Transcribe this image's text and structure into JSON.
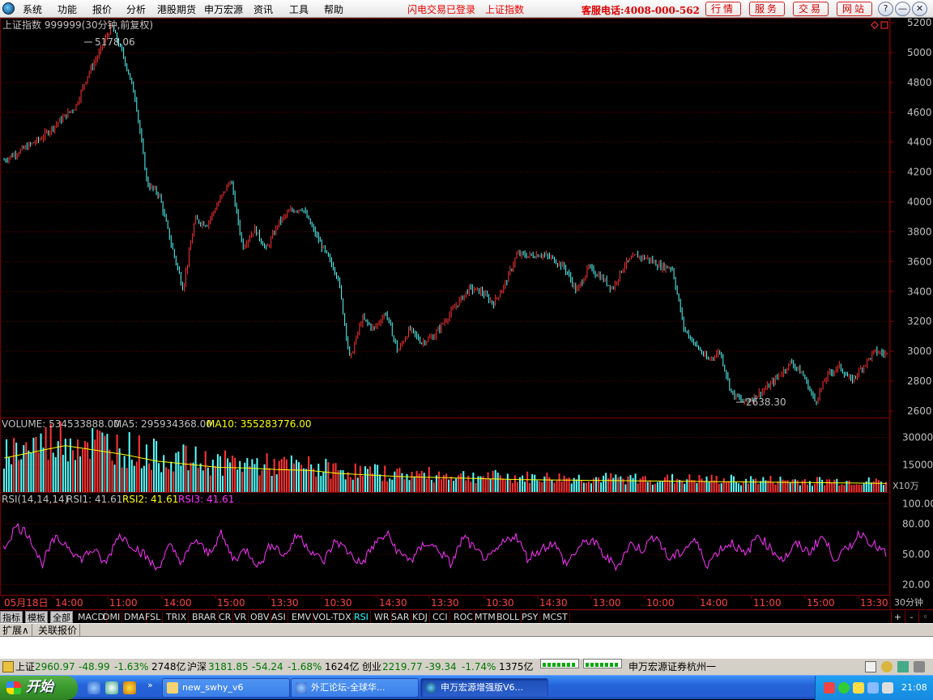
{
  "menu": {
    "items": [
      "系统",
      "功能",
      "报价",
      "分析",
      "港股期货",
      "申万宏源",
      "资讯",
      "工具",
      "帮助"
    ],
    "status_left": "闪电交易已登录",
    "status_right": "上证指数",
    "hotline": "客服电话:4008-000-562",
    "buttons": [
      "行情",
      "服务",
      "交易",
      "网站"
    ]
  },
  "window_controls": [
    "?",
    "—",
    "❐",
    "✕"
  ],
  "main_panel": {
    "title": "上证指数 999999(30分钟,前复权)",
    "high_label": "5178.06",
    "low_label": "2638.30",
    "y_ticks": [
      "5200",
      "5000",
      "4800",
      "4600",
      "4400",
      "4200",
      "4000",
      "3800",
      "3600",
      "3400",
      "3200",
      "3000",
      "2800",
      "2600"
    ]
  },
  "volume_panel": {
    "label": "VOLUME: 534533888.00",
    "ma5": "MA5: 295934368.00",
    "ma10": "MA10: 355283776.00",
    "y_ticks": [
      "30000",
      "15000"
    ],
    "unit": "X10万"
  },
  "rsi_panel": {
    "label": "RSI(14,14,14)",
    "rsi1": "RSI1: 41.61",
    "rsi2": "RSI2: 41.61",
    "rsi3": "RSI3: 41.61",
    "y_ticks": [
      "100.00",
      "80.00",
      "50.00",
      "20.00"
    ]
  },
  "x_axis": {
    "labels": [
      "05月18日",
      "14:00",
      "11:00",
      "14:00",
      "15:00",
      "13:30",
      "10:30",
      "14:30",
      "13:30",
      "10:30",
      "14:30",
      "13:00",
      "10:00",
      "14:00",
      "11:00",
      "15:00",
      "13:30",
      "10:30"
    ],
    "period": "30分钟"
  },
  "chart_data": [
    {
      "type": "candlestick",
      "title": "上证指数 999999(30分钟,前复权)",
      "y_range": [
        2600,
        5200
      ],
      "close_path": [
        [
          0,
          4280
        ],
        [
          3,
          4420
        ],
        [
          6,
          4640
        ],
        [
          7,
          4850
        ],
        [
          8,
          5000
        ],
        [
          9,
          5178.06
        ],
        [
          10,
          4980
        ],
        [
          11,
          4700
        ],
        [
          12,
          4120
        ],
        [
          13,
          4050
        ],
        [
          14,
          3720
        ],
        [
          15,
          3420
        ],
        [
          16,
          3880
        ],
        [
          17,
          3850
        ],
        [
          18,
          4000
        ],
        [
          19,
          4150
        ],
        [
          20,
          3700
        ],
        [
          21,
          3820
        ],
        [
          22,
          3680
        ],
        [
          23,
          3860
        ],
        [
          24,
          3940
        ],
        [
          25,
          3960
        ],
        [
          26,
          3800
        ],
        [
          27,
          3650
        ],
        [
          28,
          3500
        ],
        [
          29,
          2940
        ],
        [
          30,
          3220
        ],
        [
          31,
          3150
        ],
        [
          32,
          3260
        ],
        [
          33,
          3000
        ],
        [
          34,
          3150
        ],
        [
          35,
          3060
        ],
        [
          36,
          3100
        ],
        [
          37,
          3210
        ],
        [
          38,
          3320
        ],
        [
          39,
          3420
        ],
        [
          40,
          3400
        ],
        [
          41,
          3320
        ],
        [
          42,
          3450
        ],
        [
          43,
          3650
        ],
        [
          44,
          3640
        ],
        [
          45,
          3650
        ],
        [
          46,
          3620
        ],
        [
          47,
          3560
        ],
        [
          48,
          3400
        ],
        [
          49,
          3560
        ],
        [
          50,
          3500
        ],
        [
          51,
          3420
        ],
        [
          52,
          3580
        ],
        [
          53,
          3640
        ],
        [
          54,
          3620
        ],
        [
          55,
          3570
        ],
        [
          56,
          3560
        ],
        [
          57,
          3150
        ],
        [
          58,
          3040
        ],
        [
          59,
          2940
        ],
        [
          60,
          3000
        ],
        [
          61,
          2720
        ],
        [
          62,
          2660
        ],
        [
          63,
          2700
        ],
        [
          64,
          2760
        ],
        [
          65,
          2840
        ],
        [
          66,
          2930
        ],
        [
          67,
          2840
        ],
        [
          68,
          2660
        ],
        [
          69,
          2840
        ],
        [
          70,
          2900
        ],
        [
          71,
          2800
        ],
        [
          72,
          2900
        ],
        [
          73,
          3000
        ],
        [
          74,
          2980
        ]
      ]
    },
    {
      "type": "bar",
      "title": "VOLUME",
      "y_range": [
        0,
        40000
      ],
      "unit": "X10万",
      "values": [
        22000,
        26000,
        30000,
        27000,
        24000,
        20000,
        18000,
        16000,
        15500,
        14500,
        14000,
        12000,
        11000,
        10000,
        9500,
        9000,
        8500,
        8000,
        7800,
        7600,
        7400,
        7200,
        7000,
        6800,
        6600,
        6400,
        6200,
        6000,
        5800,
        5600
      ]
    },
    {
      "type": "line",
      "title": "RSI(14,14,14)",
      "y_range": [
        10,
        110
      ],
      "series": [
        {
          "name": "RSI3",
          "values": [
            55,
            78,
            70,
            40,
            65,
            60,
            45,
            55,
            40,
            70,
            60,
            50,
            35,
            58,
            42,
            65,
            50,
            70,
            45,
            55,
            38,
            62,
            48,
            70,
            55,
            42,
            64,
            52,
            40,
            60,
            70,
            50,
            45,
            62,
            55,
            40,
            68,
            52,
            45,
            60,
            70,
            46,
            55,
            62,
            40,
            57,
            65,
            48,
            38,
            60,
            55,
            70,
            45,
            52,
            65,
            40,
            55,
            62,
            48,
            70,
            55,
            45,
            60,
            52,
            68,
            46,
            55,
            72,
            60,
            50
          ]
        }
      ]
    }
  ],
  "indicator_tabs": [
    "指标",
    "模板",
    "全部",
    "MACD",
    "DMI",
    "DMA",
    "FSL",
    "TRIX",
    "BRAR",
    "CR",
    "VR",
    "OBV",
    "ASI",
    "EMV",
    "VOL-TDX",
    "RSI",
    "WR",
    "SAR",
    "KDJ",
    "CCI",
    "ROC",
    "MTM",
    "BOLL",
    "PSY",
    "MCST"
  ],
  "tab_controls": [
    "+",
    "-",
    "◦"
  ],
  "sub_tabs": [
    "扩展∧",
    "关联报价"
  ],
  "status": {
    "sh_label": "上证",
    "sh_val": "2960.97",
    "sh_chg": "-48.99",
    "sh_pct": "-1.63%",
    "sh_amt": "2748亿",
    "hs_label": "沪深",
    "hs_val": "3181.85",
    "hs_chg": "-54.24",
    "hs_pct": "-1.68%",
    "hs_amt": "1624亿",
    "cy_label": "创业",
    "cy_val": "2219.77",
    "cy_chg": "-39.34",
    "cy_pct": "-1.74%",
    "cy_amt": "1375亿",
    "broker": "申万宏源证券杭州一"
  },
  "taskbar": {
    "start": "开始",
    "windows": [
      "new_swhy_v6",
      "外汇论坛-全球华...",
      "申万宏源增强版V6..."
    ],
    "time": "21:08"
  },
  "colors": {
    "up": "#ff3333",
    "down": "#54ffff",
    "ma10": "#ffff00",
    "rsi": "#ff33ff",
    "grid": "#800000"
  }
}
